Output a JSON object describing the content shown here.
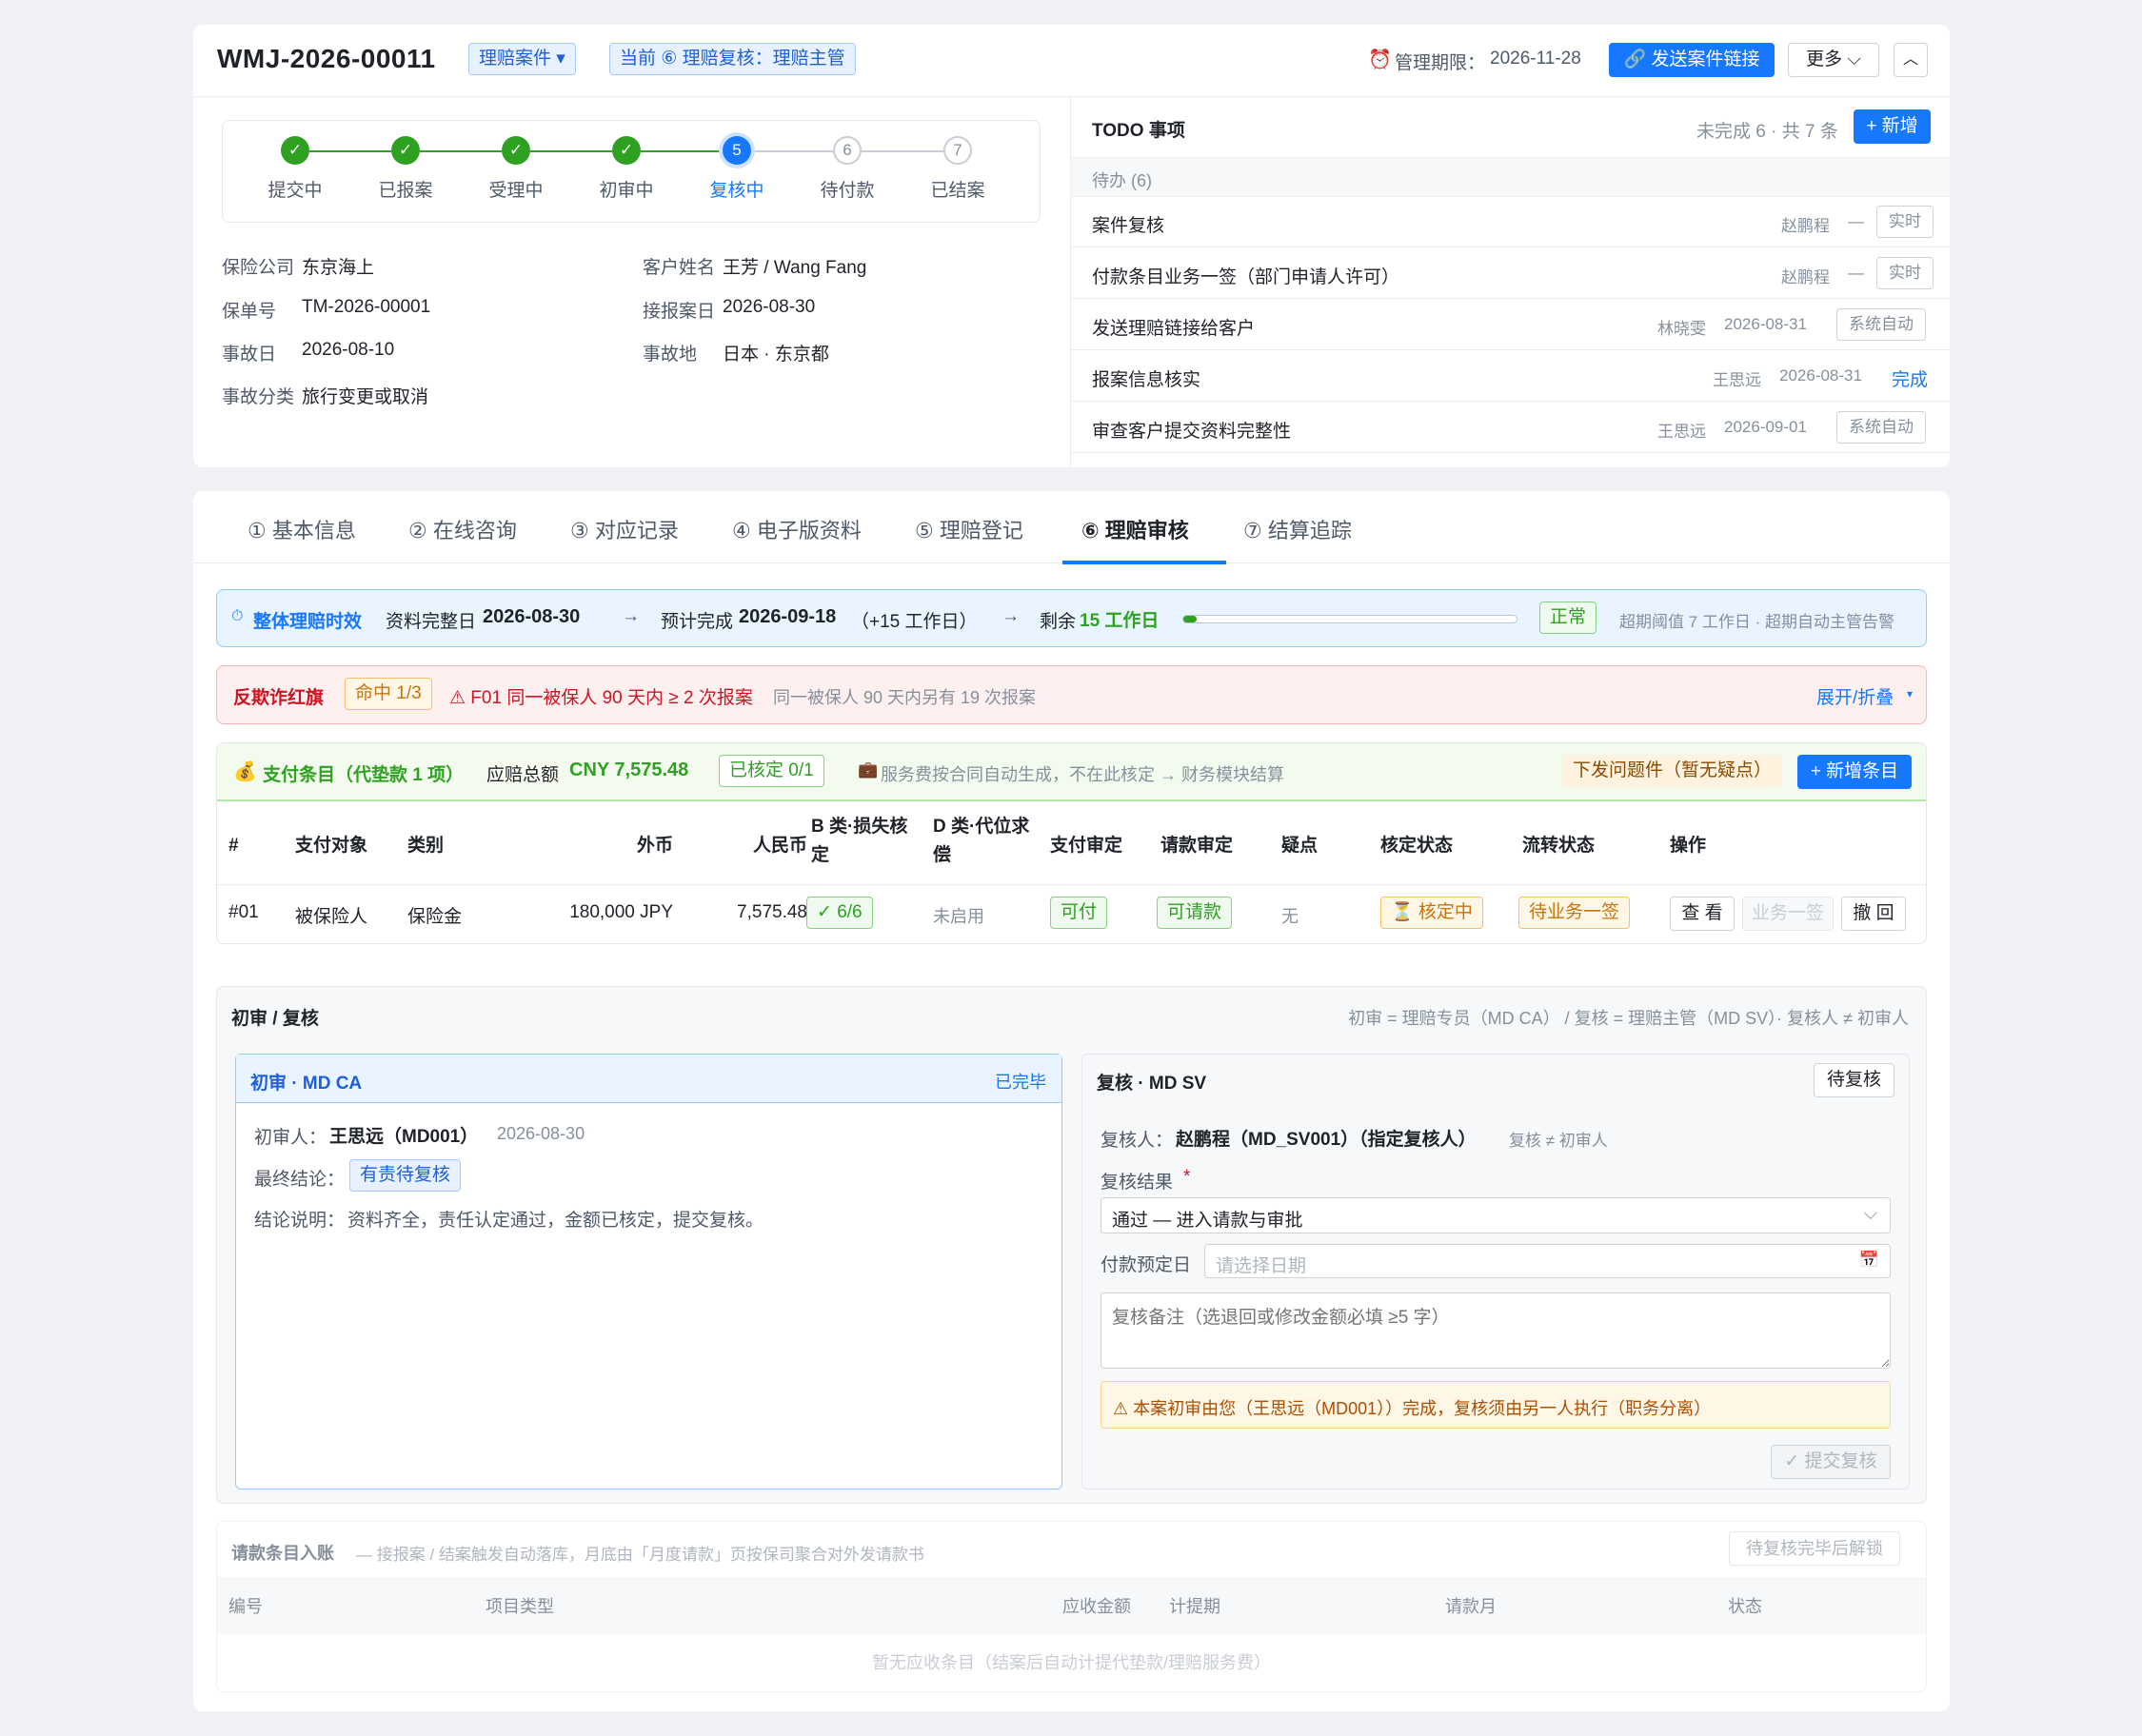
{
  "header": {
    "case_no": "WMJ-2026-00011",
    "case_type_tag": "理赔案件 ▾",
    "current_stage_tag": "当前 ⑥ 理赔复核：理赔主管",
    "deadline_label": "管理期限：",
    "deadline_value": "2026-11-28",
    "send_link_button": "发送案件链接",
    "more_button": "更多"
  },
  "steps": [
    {
      "num": "✓",
      "label": "提交中",
      "state": "done"
    },
    {
      "num": "✓",
      "label": "已报案",
      "state": "done"
    },
    {
      "num": "✓",
      "label": "受理中",
      "state": "done"
    },
    {
      "num": "✓",
      "label": "初审中",
      "state": "done"
    },
    {
      "num": "5",
      "label": "复核中",
      "state": "cur"
    },
    {
      "num": "6",
      "label": "待付款",
      "state": "todo"
    },
    {
      "num": "7",
      "label": "已结案",
      "state": "todo"
    }
  ],
  "info": {
    "insurer_label": "保险公司",
    "insurer": "东京海上",
    "customer_label": "客户姓名",
    "customer": "王芳 / Wang Fang",
    "policy_label": "保单号",
    "policy": "TM-2026-00001",
    "accept_label": "接报案日",
    "accept": "2026-08-30",
    "accident_date_label": "事故日",
    "accident_date": "2026-08-10",
    "place_label": "事故地",
    "place": "日本 · 东京都",
    "category_label": "事故分类",
    "category": "旅行变更或取消"
  },
  "todo": {
    "title": "TODO 事项",
    "summary": "未完成 6 · 共 7 条",
    "add_button": "+ 新增",
    "section": "待办 (6)",
    "items": [
      {
        "title": "案件复核",
        "who": "赵鹏程",
        "date": "—",
        "status": "实时"
      },
      {
        "title": "付款条目业务一签（部门申请人许可）",
        "who": "赵鹏程",
        "date": "—",
        "status": "实时"
      },
      {
        "title": "发送理赔链接给客户",
        "who": "林晓雯",
        "date": "2026-08-31",
        "status": "系统自动"
      },
      {
        "title": "报案信息核实",
        "who": "王思远",
        "date": "2026-08-31",
        "status": "完成"
      },
      {
        "title": "审查客户提交资料完整性",
        "who": "王思远",
        "date": "2026-09-01",
        "status": "系统自动"
      }
    ]
  },
  "tabs": [
    "① 基本信息",
    "② 在线咨询",
    "③ 对应记录",
    "④ 电子版资料",
    "⑤ 理赔登记",
    "⑥ 理赔审核",
    "⑦ 结算追踪"
  ],
  "active_tab": 5,
  "timeline": {
    "title": "整体理赔时效",
    "complete_label": "资料完整日",
    "complete_date": "2026-08-30",
    "expected_label": "预计完成",
    "expected_date": "2026-09-18",
    "expected_extra": "（+15 工作日）",
    "remain_label": "剩余",
    "remain_value": "15 工作日",
    "progress": 0.04,
    "status": "正常",
    "note": "超期阈值 7 工作日 · 超期自动主管告警"
  },
  "fraud": {
    "title": "反欺诈红旗",
    "hit": "命中 1/3",
    "rule": "⚠ F01 同一被保人 90 天内 ≥ 2 次报案",
    "detail": "同一被保人 90 天内另有 19 次报案",
    "toggle": "展开/折叠"
  },
  "payment": {
    "title": "支付条目（代垫款 1 项）",
    "total_label": "应赔总额",
    "total_value": "CNY 7,575.48",
    "verified": "已核定 0/1",
    "note": "服务费按合同自动生成，不在此核定 → 财务模块结算",
    "issue_button": "下发问题件（暂无疑点）",
    "add_button": "+ 新增条目",
    "columns": [
      "#",
      "支付对象",
      "类别",
      "外币",
      "人民币",
      "B 类·损失核定",
      "D 类·代位求偿",
      "支付审定",
      "请款审定",
      "疑点",
      "核定状态",
      "流转状态",
      "操作"
    ],
    "row": {
      "no": "#01",
      "payee": "被保险人",
      "category": "保险金",
      "foreign": "180,000 JPY",
      "cny": "7,575.48",
      "b_check": "✓ 6/6",
      "d_check": "未启用",
      "pay_ok": "可付",
      "claim_ok": "可请款",
      "doubt": "无",
      "verify_status": "⏳ 核定中",
      "flow_status": "待业务一签",
      "ops": [
        "查 看",
        "业务一签",
        "撤 回"
      ]
    }
  },
  "review": {
    "title": "初审 / 复核",
    "rule": "初审 = 理赔专员（MD CA） / 复核 = 理赔主管（MD SV）· 复核人 ≠ 初审人",
    "first": {
      "title": "初审 · MD CA",
      "state": "已完毕",
      "reviewer_label": "初审人：",
      "reviewer": "王思远（MD001）",
      "date": "2026-08-30",
      "conclusion_label": "最终结论：",
      "conclusion": "有责待复核",
      "desc_label": "结论说明：",
      "desc": "资料齐全，责任认定通过，金额已核定，提交复核。"
    },
    "second": {
      "title": "复核 · MD SV",
      "state": "待复核",
      "reviewer_label": "复核人：",
      "reviewer": "赵鹏程（MD_SV001）（指定复核人）",
      "reviewer_note": "复核 ≠ 初审人",
      "result_label": "复核结果",
      "result_value": "通过 — 进入请款与审批",
      "pay_date_label": "付款预定日",
      "pay_date_placeholder": "请选择日期",
      "remark_placeholder": "复核备注（选退回或修改金额必填 ≥5 字）",
      "warning": "⚠ 本案初审由您（王思远（MD001））完成，复核须由另一人执行（职务分离）",
      "submit": "✓ 提交复核"
    }
  },
  "ledger": {
    "title": "请款条目入账",
    "note": "— 接报案 / 结案触发自动落库，月底由「月度请款」页按保司聚合对外发请款书",
    "lock": "待复核完毕后解锁",
    "columns": [
      "编号",
      "项目类型",
      "应收金额",
      "计提期",
      "请款月",
      "状态"
    ],
    "empty": "暂无应收条目（结案后自动计提代垫款/理赔服务费）"
  },
  "colors": {
    "primary": "#1677ff",
    "success": "#2ea121",
    "danger": "#cf1322",
    "warning": "#c7740c"
  }
}
